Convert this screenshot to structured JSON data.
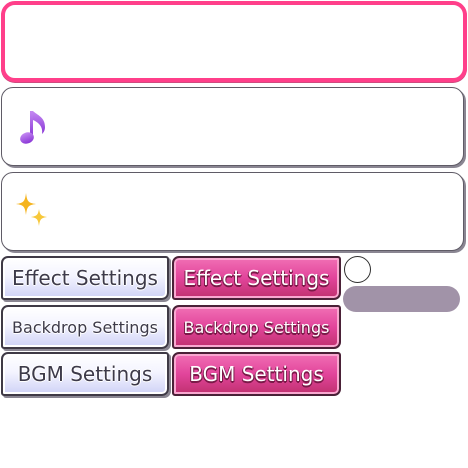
{
  "panels": [
    {
      "name": "empty-panel",
      "state": "selected",
      "accent": "#ff3f8a"
    },
    {
      "name": "music-panel",
      "icon": "music-note-icon",
      "icon_color": "#a24de6"
    },
    {
      "name": "effects-panel",
      "icon": "sparkle-icon",
      "icon_color": "#f5b41f"
    }
  ],
  "buttons": {
    "effect_settings": "Effect Settings",
    "backdrop_settings": "Backdrop Settings",
    "bgm_settings": "BGM Settings"
  },
  "colors": {
    "pink_button": "#e2459b",
    "light_button": "#e8e9fc",
    "slider_track": "#a193a8"
  }
}
